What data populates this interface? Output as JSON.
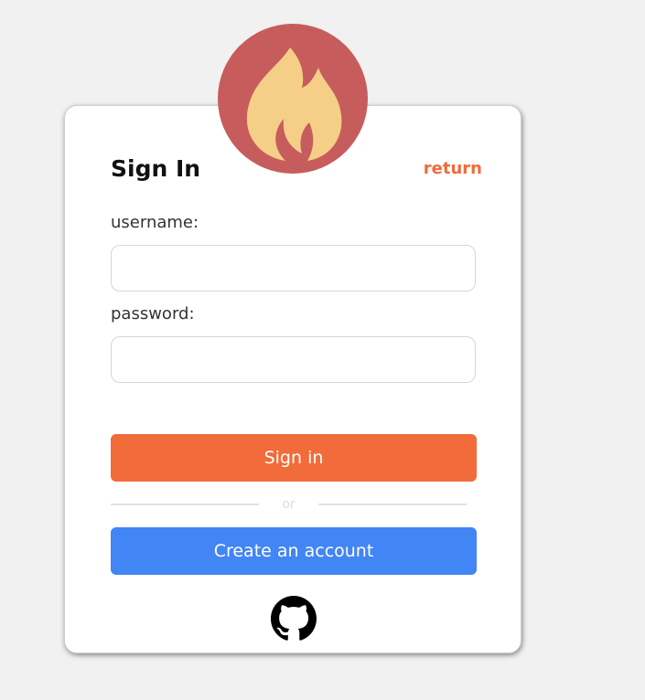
{
  "card": {
    "title": "Sign In",
    "return_label": "return"
  },
  "form": {
    "username_label": "username:",
    "username_value": "",
    "password_label": "password:",
    "password_value": ""
  },
  "actions": {
    "signin_label": "Sign in",
    "divider_text": "or",
    "create_label": "Create an account"
  },
  "icons": {
    "logo": "flame-icon",
    "social": "github-icon"
  },
  "colors": {
    "background": "#f1f1f1",
    "logo_circle": "#c75c5c",
    "flame": "#f5cf87",
    "accent_orange": "#f26b3a",
    "accent_blue": "#4285f4"
  }
}
